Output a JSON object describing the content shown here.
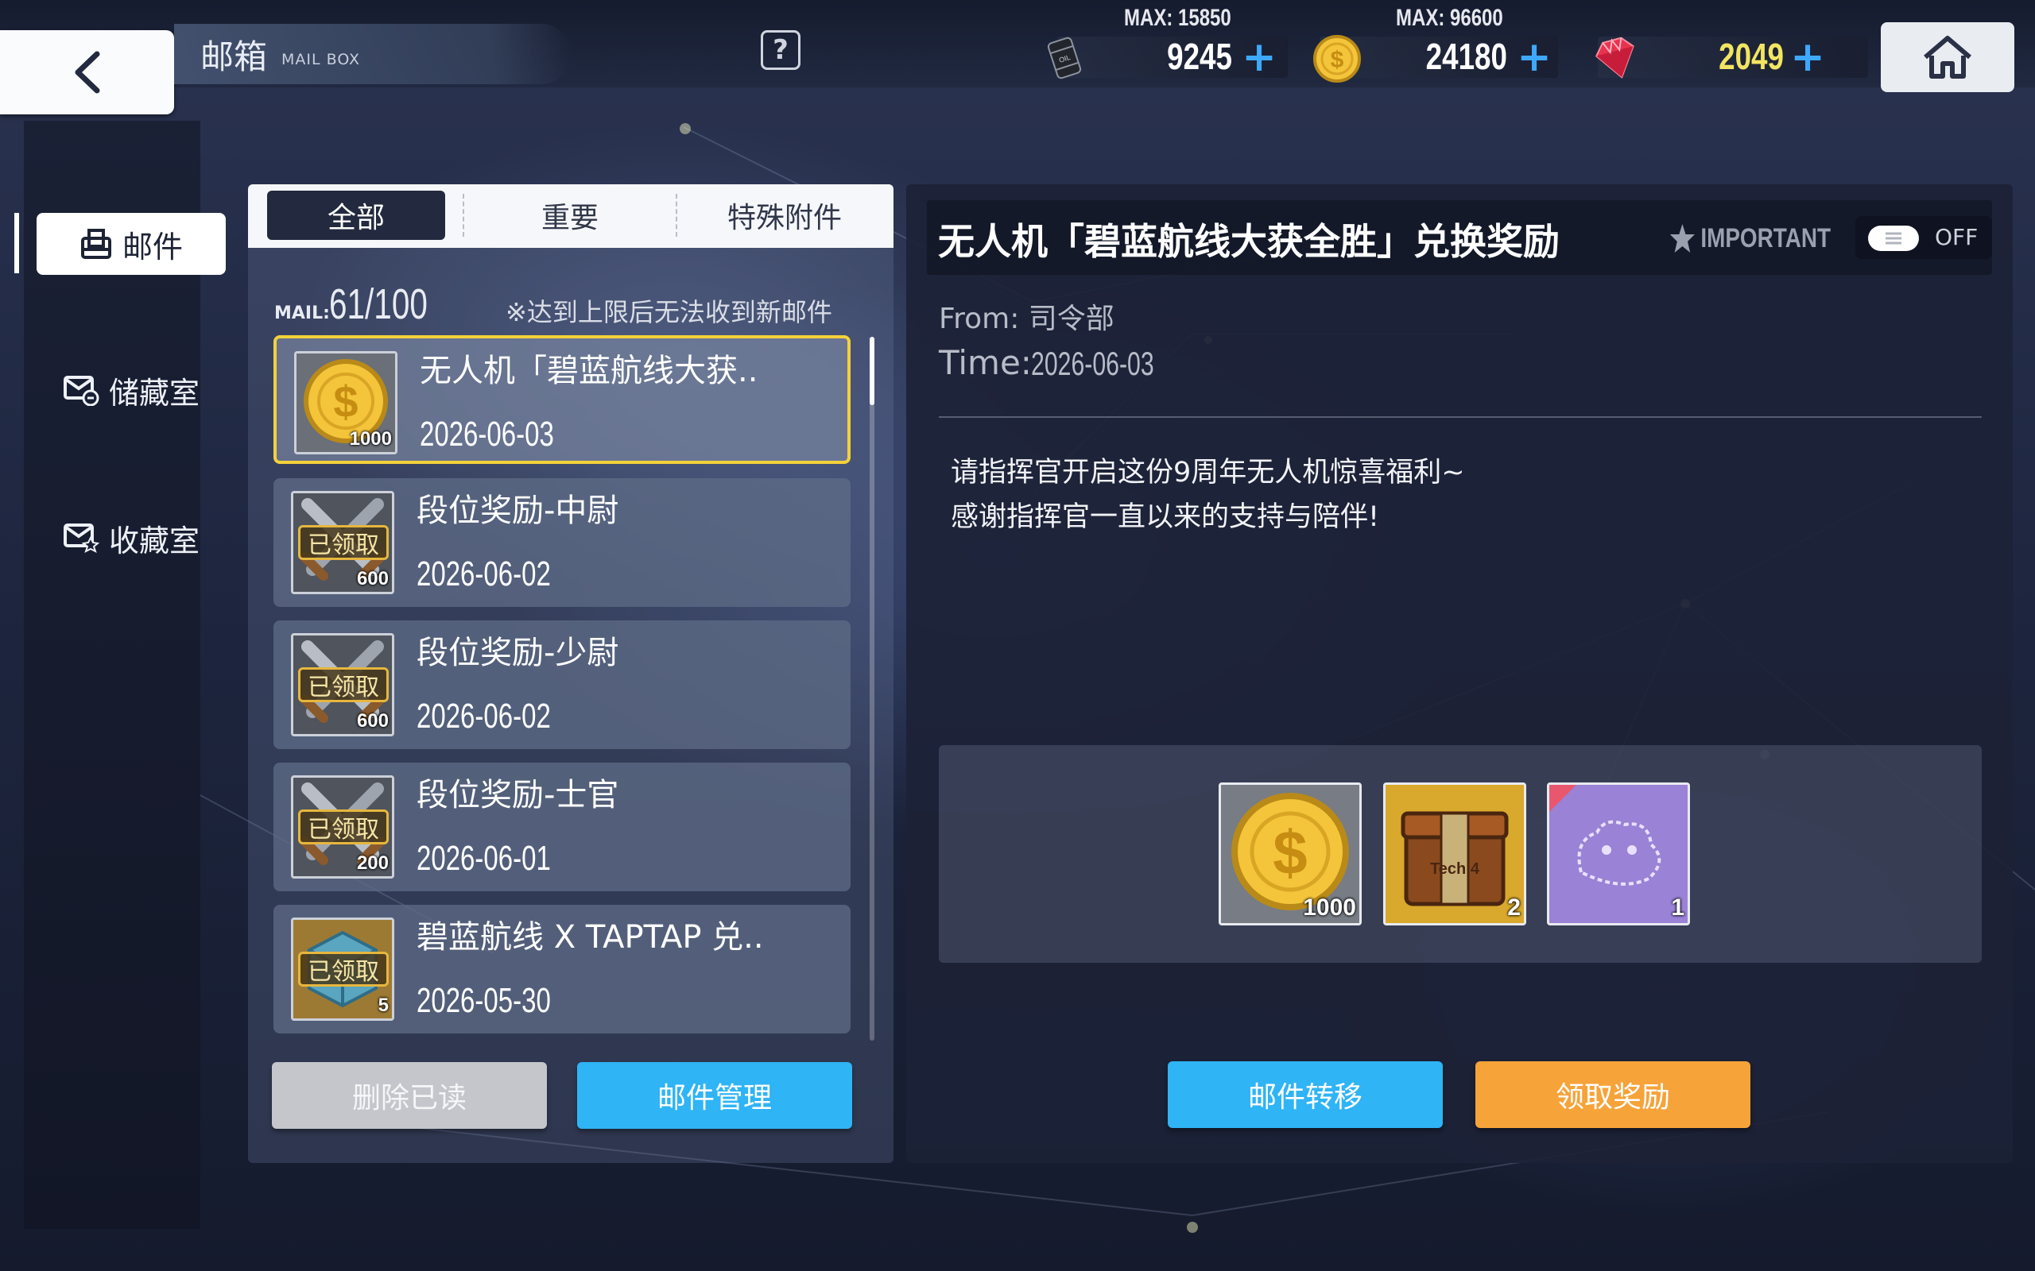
{
  "header": {
    "title": "邮箱",
    "subtitle": "MAIL BOX",
    "help_label": "?"
  },
  "resources": [
    {
      "name": "oil",
      "icon": "oil-barrel-icon",
      "max_label": "MAX: 15850",
      "value": "9245"
    },
    {
      "name": "coin",
      "icon": "coin-icon",
      "max_label": "MAX: 96600",
      "value": "24180"
    },
    {
      "name": "gem",
      "icon": "gem-icon",
      "max_label": "",
      "value": "2049",
      "color": "#f2e562"
    }
  ],
  "sidebar": {
    "items": [
      {
        "label": "邮件",
        "icon": "mail-tray-icon",
        "active": true
      },
      {
        "label": "储藏室",
        "icon": "mail-storage-icon",
        "active": false
      },
      {
        "label": "收藏室",
        "icon": "mail-collect-icon",
        "active": false
      }
    ]
  },
  "tabs": [
    {
      "label": "全部",
      "active": true
    },
    {
      "label": "重要",
      "active": false
    },
    {
      "label": "特殊附件",
      "active": false
    }
  ],
  "mailbox": {
    "count_label": "MAIL:",
    "count": "61/100",
    "note": "※达到上限后无法收到新邮件"
  },
  "mails": [
    {
      "title": "无人机「碧蓝航线大获..",
      "date": "2026-06-03",
      "icon": "gold-coin-icon",
      "qty": "1000",
      "claimed": false,
      "selected": true
    },
    {
      "title": "段位奖励-中尉",
      "date": "2026-06-02",
      "icon": "crossed-swords-icon",
      "qty": "600",
      "claimed": true,
      "claimed_label": "已领取"
    },
    {
      "title": "段位奖励-少尉",
      "date": "2026-06-02",
      "icon": "crossed-swords-icon",
      "qty": "600",
      "claimed": true,
      "claimed_label": "已领取"
    },
    {
      "title": "段位奖励-士官",
      "date": "2026-06-01",
      "icon": "crossed-swords-icon",
      "qty": "200",
      "claimed": true,
      "claimed_label": "已领取"
    },
    {
      "title": "碧蓝航线 X TAPTAP 兑..",
      "date": "2026-05-30",
      "icon": "cube-icon",
      "qty": "5",
      "claimed": true,
      "claimed_label": "已领取"
    }
  ],
  "list_actions": {
    "delete_read": "删除已读",
    "manage": "邮件管理"
  },
  "detail": {
    "subject": "无人机「碧蓝航线大获全胜」兑换奖励",
    "important_label": "IMPORTANT",
    "toggle_label": "OFF",
    "from_label": "From: 司令部",
    "time_label": "Time:",
    "time_value": "2026-06-03",
    "body": [
      "请指挥官开启这份9周年无人机惊喜福利~",
      "感谢指挥官一直以来的支持与陪伴!"
    ],
    "attachments": [
      {
        "icon": "gold-coin-icon",
        "qty": "1000"
      },
      {
        "icon": "tech-box-icon",
        "qty": "2",
        "label": "Tech 4"
      },
      {
        "icon": "furniture-item-icon",
        "qty": "1"
      }
    ],
    "transfer_label": "邮件转移",
    "claim_label": "领取奖励"
  },
  "colors": {
    "accent_blue": "#2fb4f5",
    "claim_orange": "#f6a33a",
    "selected_border": "#f3d13a"
  }
}
